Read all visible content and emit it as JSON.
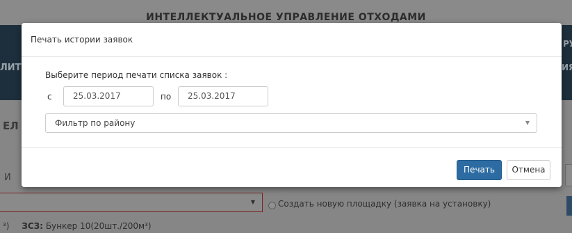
{
  "background": {
    "app_title": "ИНТЕЛЛЕКТУАЛЬНОЕ УПРАВЛЕНИЕ ОТХОДАМИ",
    "nav_left_fragment": "ЛИТ",
    "nav_right_fragment_1": "РУ",
    "nav_right_fragment_2": "ИЯ",
    "section_label_fragment": "ЕЛ",
    "row_label_fragment": "И",
    "create_site_radio_label": "Создать новую площадку (заявка на установку)",
    "bottom_row_prefix": "³)",
    "bottom_row_label": "ЗСЗ:",
    "bottom_row_value": "Бункер 10(20шт./200м³)"
  },
  "modal": {
    "title": "Печать истории заявок",
    "prompt": "Выберите период печати списка заявок :",
    "from_label": "с",
    "from_value": "25.03.2017",
    "to_label": "по",
    "to_value": "25.03.2017",
    "district_filter": "Фильтр по району",
    "print_button": "Печать",
    "cancel_button": "Отмена"
  },
  "colors": {
    "primary_button": "#2d6ca2",
    "overlay_nav": "#1d2f3c",
    "error_border": "#7a2424"
  },
  "icons": {
    "dropdown": "chevron-down-icon",
    "radio": "radio-icon"
  }
}
